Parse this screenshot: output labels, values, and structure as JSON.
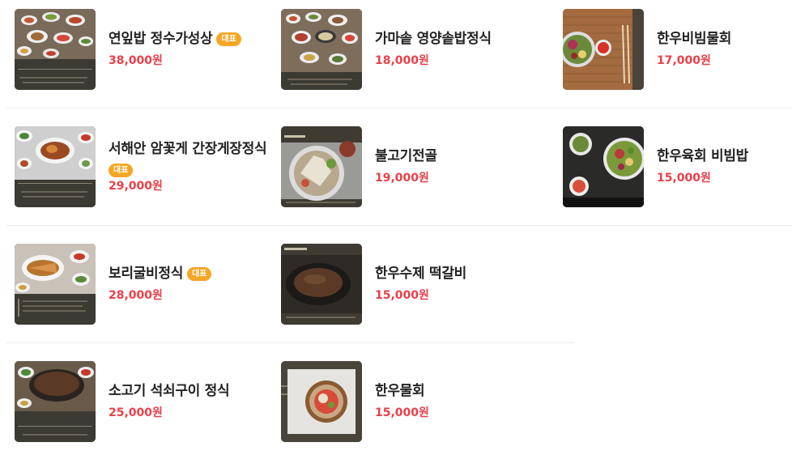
{
  "menu": {
    "items": [
      {
        "name": "연잎밥 정수가성상",
        "badge": "대표",
        "price": "38,000원"
      },
      {
        "name": "가마솥 영양솥밥정식",
        "price": "18,000원"
      },
      {
        "name": "한우비빔물회",
        "price": "17,000원"
      },
      {
        "name": "서해안 암꽃게 간장게장정식",
        "badge": "대표",
        "price": "29,000원"
      },
      {
        "name": "불고기전골",
        "price": "19,000원"
      },
      {
        "name": "한우육회 비빔밥",
        "price": "15,000원"
      },
      {
        "name": "보리굴비정식",
        "badge": "대표",
        "price": "28,000원"
      },
      {
        "name": "한우수제 떡갈비",
        "price": "15,000원"
      },
      {
        "name": "소고기 석쇠구이 정식",
        "price": "25,000원"
      },
      {
        "name": "한우물회",
        "price": "15,000원"
      }
    ]
  },
  "colors": {
    "price": "#e8404a",
    "badge": "#f5a623",
    "thumb_frame": "#3d3a33"
  }
}
